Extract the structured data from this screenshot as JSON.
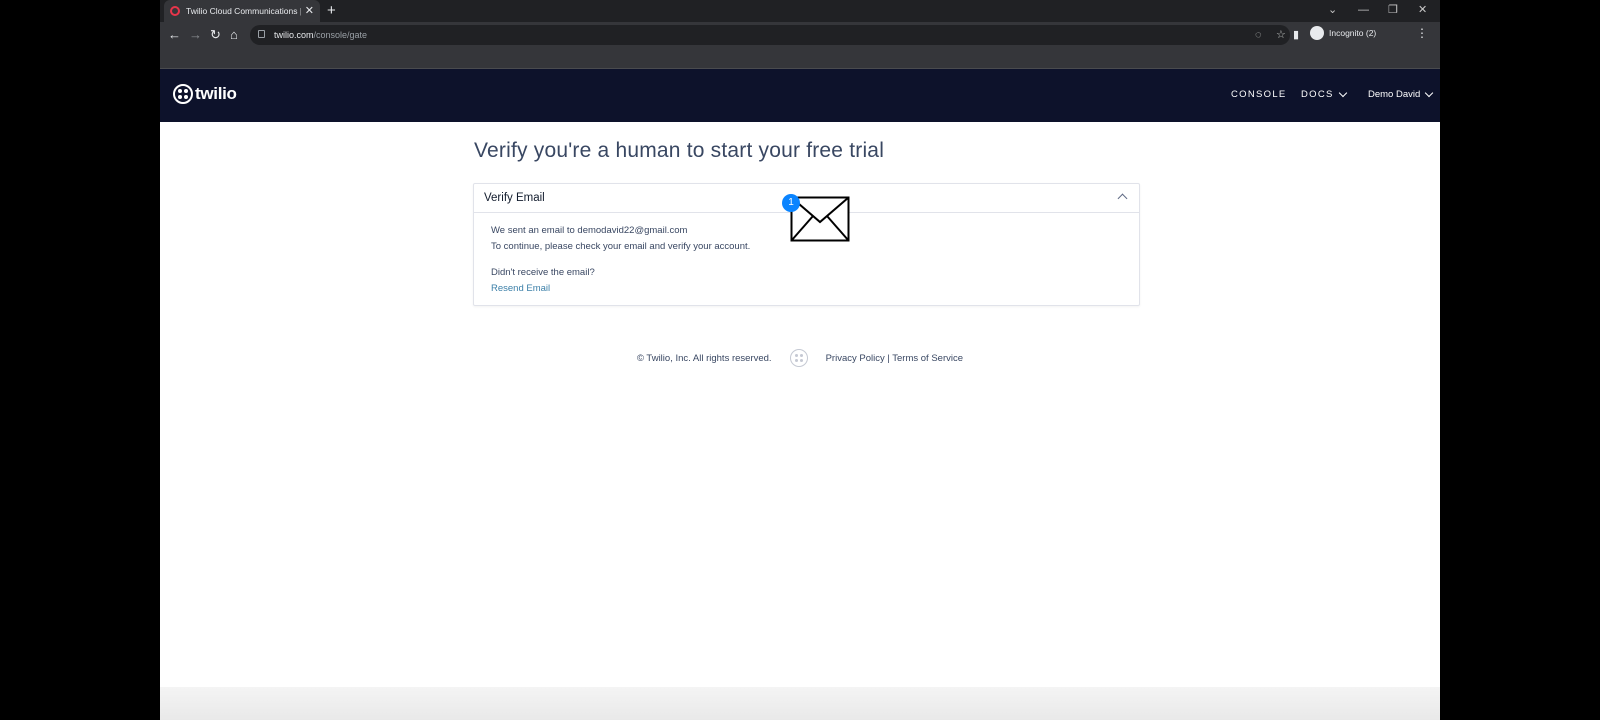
{
  "browser": {
    "tab_title": "Twilio Cloud Communications | W",
    "url_host": "twilio.com",
    "url_path": "/console/gate",
    "profile_label": "Incognito (2)"
  },
  "header": {
    "logo_text": "twilio",
    "nav": [
      "CONSOLE",
      "DOCS"
    ],
    "user": "Demo David"
  },
  "page": {
    "title": "Verify you're a human to start your free trial",
    "card": {
      "title": "Verify Email",
      "sent_line": "We sent an email to demodavid22@gmail.com",
      "continue_line": "To continue, please check your email and verify your account.",
      "question": "Didn't receive the email?",
      "resend_link": "Resend Email",
      "badge_count": "1"
    }
  },
  "footer": {
    "copyright": "© Twilio, Inc. All rights reserved.",
    "links": "Privacy Policy | Terms of Service"
  },
  "colors": {
    "header_bg": "#0d122b",
    "badge": "#0a84ff",
    "link": "#3b7fa8"
  }
}
